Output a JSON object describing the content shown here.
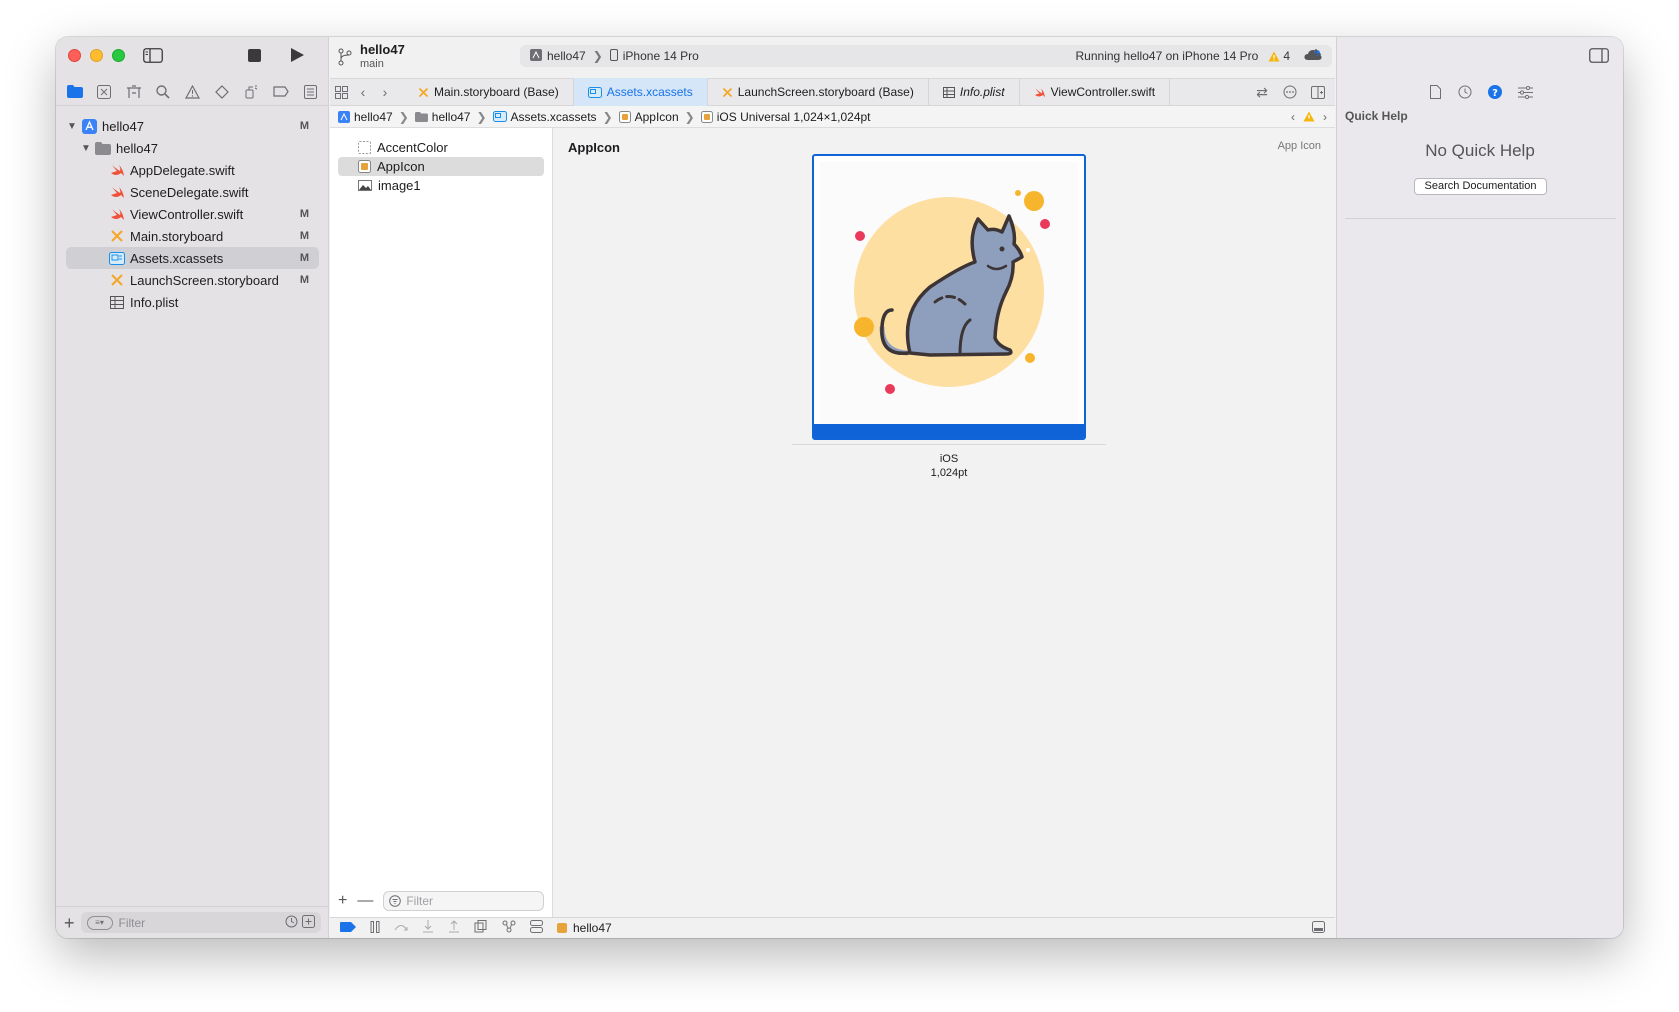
{
  "toolbar": {
    "project_name": "hello47",
    "branch": "main",
    "scheme": "hello47",
    "device": "iPhone 14 Pro",
    "status": "Running hello47 on iPhone 14 Pro",
    "warning_count": "4"
  },
  "navigator": {
    "items": [
      {
        "label": "hello47",
        "badge": "M"
      },
      {
        "label": "hello47",
        "badge": ""
      },
      {
        "label": "AppDelegate.swift",
        "badge": ""
      },
      {
        "label": "SceneDelegate.swift",
        "badge": ""
      },
      {
        "label": "ViewController.swift",
        "badge": "M"
      },
      {
        "label": "Main.storyboard",
        "badge": "M"
      },
      {
        "label": "Assets.xcassets",
        "badge": "M"
      },
      {
        "label": "LaunchScreen.storyboard",
        "badge": "M"
      },
      {
        "label": "Info.plist",
        "badge": ""
      }
    ],
    "filter_placeholder": "Filter"
  },
  "tabs": [
    {
      "label": "Main.storyboard (Base)"
    },
    {
      "label": "Assets.xcassets"
    },
    {
      "label": "LaunchScreen.storyboard (Base)"
    },
    {
      "label": "Info.plist"
    },
    {
      "label": "ViewController.swift"
    }
  ],
  "jumpbar": {
    "crumbs": [
      "hello47",
      "hello47",
      "Assets.xcassets",
      "AppIcon",
      "iOS Universal 1,024×1,024pt"
    ]
  },
  "assets": {
    "items": [
      "AccentColor",
      "AppIcon",
      "image1"
    ],
    "filter_placeholder": "Filter"
  },
  "detail": {
    "title": "AppIcon",
    "type": "App Icon",
    "platform": "iOS",
    "size": "1,024pt"
  },
  "debug": {
    "target": "hello47"
  },
  "inspector": {
    "title": "Quick Help",
    "empty_message": "No Quick Help",
    "search_button": "Search Documentation"
  },
  "colors": {
    "accent": "#1a73e8",
    "selection_blue": "#0f63d6",
    "swift_orange": "#f05138",
    "storyboard_orange": "#f5a623",
    "warning_yellow": "#f5b50a"
  }
}
